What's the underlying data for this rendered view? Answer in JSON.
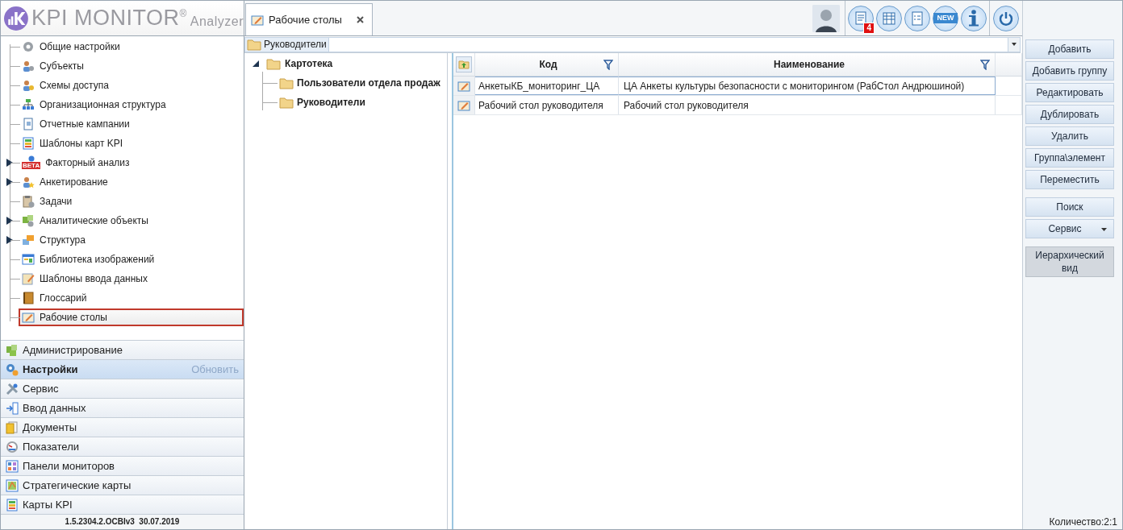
{
  "logo": {
    "brand": "KPI MONITOR$^{®}$",
    "subtitle": "Analyzer"
  },
  "nav_tree": [
    {
      "label": "Общие настройки",
      "has_children": false,
      "selected": false
    },
    {
      "label": "Субъекты",
      "has_children": false,
      "selected": false
    },
    {
      "label": "Схемы доступа",
      "has_children": false,
      "selected": false
    },
    {
      "label": "Организационная структура",
      "has_children": false,
      "selected": false
    },
    {
      "label": "Отчетные кампании",
      "has_children": false,
      "selected": false
    },
    {
      "label": "Шаблоны карт KPI",
      "has_children": false,
      "selected": false
    },
    {
      "label": "Факторный анализ",
      "has_children": true,
      "selected": false,
      "badge": "BETA"
    },
    {
      "label": "Анкетирование",
      "has_children": true,
      "selected": false
    },
    {
      "label": "Задачи",
      "has_children": false,
      "selected": false
    },
    {
      "label": "Аналитические объекты",
      "has_children": true,
      "selected": false
    },
    {
      "label": "Структура",
      "has_children": true,
      "selected": false
    },
    {
      "label": "Библиотека изображений",
      "has_children": false,
      "selected": false
    },
    {
      "label": "Шаблоны ввода данных",
      "has_children": false,
      "selected": false
    },
    {
      "label": "Глоссарий",
      "has_children": false,
      "selected": false
    },
    {
      "label": "Рабочие столы",
      "has_children": false,
      "selected": true
    }
  ],
  "sections": [
    {
      "label": "Администрирование",
      "selected": false
    },
    {
      "label": "Настройки",
      "selected": true,
      "action": "Обновить"
    },
    {
      "label": "Сервис",
      "selected": false
    },
    {
      "label": "Ввод данных",
      "selected": false
    },
    {
      "label": "Документы",
      "selected": false
    },
    {
      "label": "Показатели",
      "selected": false
    },
    {
      "label": "Панели мониторов",
      "selected": false
    },
    {
      "label": "Стратегические карты",
      "selected": false
    },
    {
      "label": "Карты KPI",
      "selected": false
    }
  ],
  "version": "1.5.2304.2.OCBIv3  30.07.2019",
  "tabs": [
    {
      "label": "Рабочие столы",
      "selected": true
    }
  ],
  "toolbar": {
    "notification_badge": "4",
    "new_label": "NEW"
  },
  "breadcrumb": "Руководители",
  "folder_tree": {
    "label": "Картотека",
    "expanded": true,
    "children": [
      {
        "label": "Пользователи отдела продаж"
      },
      {
        "label": "Руководители"
      }
    ]
  },
  "grid": {
    "columns": [
      "Код",
      "Наименование"
    ],
    "rows": [
      {
        "code": "АнкетыКБ_мониторинг_ЦА",
        "name": "ЦА Анкеты культуры безопасности с мониторингом (РабСтол Андрюшиной)",
        "selected": true
      },
      {
        "code": "Рабочий стол руководителя",
        "name": "Рабочий стол руководителя",
        "selected": false
      }
    ]
  },
  "action_groups": [
    [
      {
        "label": "Добавить",
        "kind": "button"
      },
      {
        "label": "Добавить группу",
        "kind": "button"
      },
      {
        "label": "Редактировать",
        "kind": "button"
      },
      {
        "label": "Дублировать",
        "kind": "button"
      },
      {
        "label": "Удалить",
        "kind": "button"
      },
      {
        "label": "Группа\\элемент",
        "kind": "button"
      },
      {
        "label": "Переместить",
        "kind": "button"
      }
    ],
    [
      {
        "label": "Поиск",
        "kind": "button"
      },
      {
        "label": "Сервис",
        "kind": "dropdown"
      }
    ],
    [
      {
        "label": "Иерархический вид",
        "kind": "toggle",
        "on": true
      }
    ]
  ],
  "status": "Количество:2:1"
}
